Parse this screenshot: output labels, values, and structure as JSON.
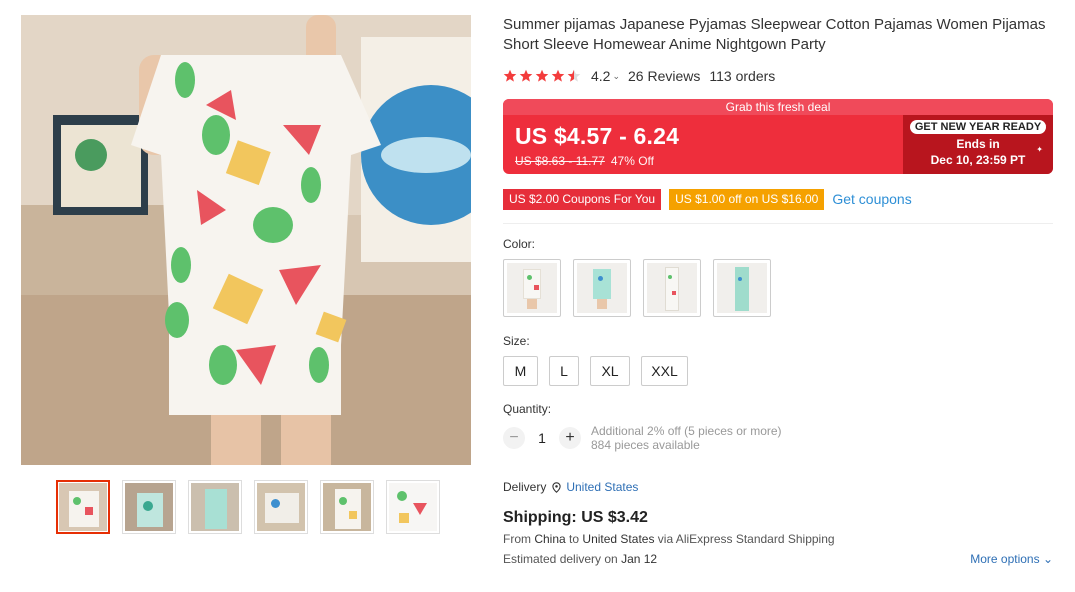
{
  "product": {
    "title": "Summer pijamas Japanese Pyjamas Sleepwear Cotton Pajamas Women Pijamas Short Sleeve Homewear Anime Nightgown Party",
    "rating": "4.2",
    "rating_value": 4.5,
    "reviews": "26 Reviews",
    "orders": "113 orders"
  },
  "deal": {
    "banner": "Grab this fresh deal",
    "price": "US $4.57 - 6.24",
    "original_price": "US $8.63 - 11.77",
    "discount": "47% Off",
    "badge": "GET NEW YEAR READY",
    "ends_label": "Ends in",
    "ends_date": "Dec 10, 23:59 PT"
  },
  "coupons": {
    "store_coupon": "US $2.00 Coupons For You",
    "select_coupon": "US $1.00 off on US $16.00",
    "get_coupons": "Get coupons"
  },
  "color": {
    "label": "Color:",
    "options": [
      "shorts-white",
      "shorts-teal",
      "long-white",
      "long-teal"
    ]
  },
  "size": {
    "label": "Size:",
    "options": [
      "M",
      "L",
      "XL",
      "XXL"
    ]
  },
  "quantity": {
    "label": "Quantity:",
    "value": "1",
    "minus": "−",
    "plus": "+",
    "discount_note": "Additional 2% off (5 pieces or more)",
    "available": "884 pieces available"
  },
  "delivery": {
    "label": "Delivery",
    "country": "United States",
    "shipping": "Shipping: US $3.42",
    "from": "From",
    "origin": "China",
    "to": "to",
    "destination": "United States",
    "via": "via AliExpress Standard Shipping",
    "estimated": "Estimated delivery on",
    "date": "Jan 12",
    "more_options": "More options"
  },
  "colors": {
    "accent": "#e62e04",
    "price_bg": "#ee2e3c",
    "deal_dark": "#b8151e",
    "coupon_orange": "#f5a100",
    "link": "#2e8fd6",
    "star": "#f33c3c"
  },
  "icons": [
    "star-icon",
    "chevron-down-icon",
    "location-pin-icon",
    "sparkle-icon"
  ]
}
